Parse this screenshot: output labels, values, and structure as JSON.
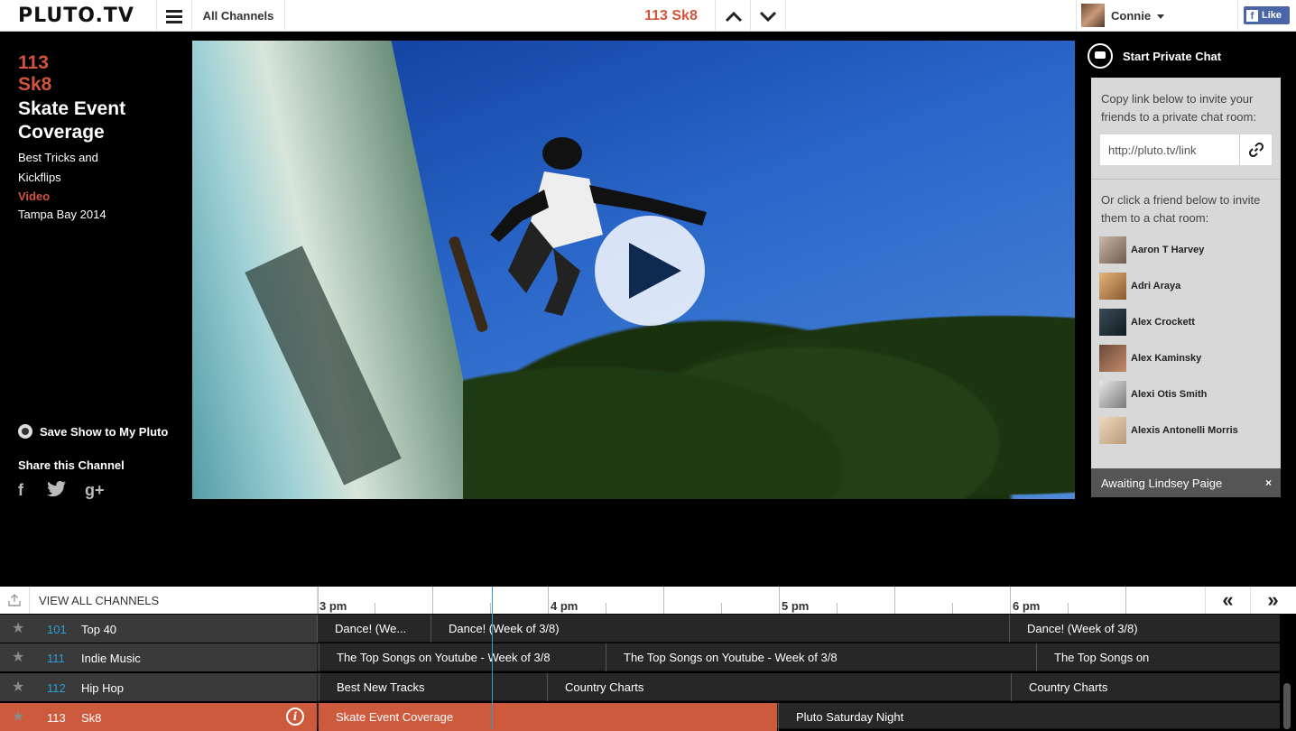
{
  "header": {
    "logo": "PLUTO.TV",
    "all_channels": "All Channels",
    "current_channel": "113 Sk8",
    "user_name": "Connie",
    "like_label": "Like"
  },
  "show": {
    "number": "113",
    "channel": "Sk8",
    "title": "Skate Event Coverage",
    "subtitle": "Best Tricks and Kickflips",
    "type": "Video",
    "event": "Tampa Bay 2014",
    "save_label": "Save Show to My Pluto",
    "share_title": "Share this Channel",
    "social_icons": [
      "facebook-icon",
      "twitter-icon",
      "google-plus-icon"
    ]
  },
  "chat": {
    "title": "Start Private Chat",
    "invite_text": "Copy link below to invite your friends to a private chat room:",
    "link_value": "http://pluto.tv/link",
    "friend_text": "Or click a friend below to invite them to a chat room:",
    "friends": [
      {
        "name": "Aaron T Harvey"
      },
      {
        "name": "Adri Araya"
      },
      {
        "name": "Alex Crockett"
      },
      {
        "name": "Alex Kaminsky"
      },
      {
        "name": "Alexi Otis Smith"
      },
      {
        "name": "Alexis Antonelli Morris"
      }
    ],
    "awaiting": "Awaiting Lindsey Paige",
    "close": "×"
  },
  "guide": {
    "view_all": "VIEW ALL CHANNELS",
    "times": [
      "3 pm",
      "4 pm",
      "5 pm",
      "6 pm"
    ],
    "prev": "«",
    "next": "»",
    "rows": [
      {
        "number": "101",
        "name": "Top 40",
        "programs": [
          "Dance! (We...",
          "Dance! (Week of 3/8)",
          "Dance! (Week of 3/8)"
        ]
      },
      {
        "number": "111",
        "name": "Indie Music",
        "programs": [
          "The Top Songs on Youtube - Week of 3/8",
          "The Top Songs on Youtube - Week of 3/8",
          "The Top Songs on"
        ]
      },
      {
        "number": "112",
        "name": "Hip Hop",
        "programs": [
          "Best New Tracks",
          "Country Charts",
          "Country Charts"
        ]
      },
      {
        "number": "113",
        "name": "Sk8",
        "programs": [
          "Skate Event Coverage",
          "Pluto Saturday Night"
        ]
      }
    ]
  },
  "colors": {
    "accent": "#d2553b",
    "channel_number": "#2a9fd8",
    "facebook": "#4a66a8"
  }
}
